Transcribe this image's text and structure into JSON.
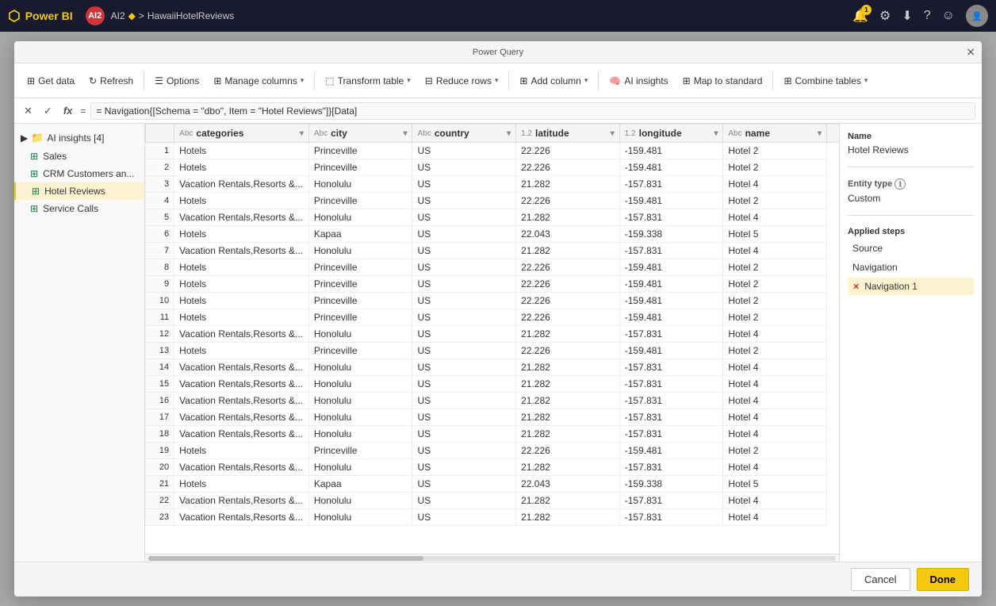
{
  "topbar": {
    "logo": "Power BI",
    "workspace": "AI2",
    "separator": ">",
    "file": "HawaiiHotelReviews",
    "notification_count": "1",
    "icons": [
      "bell",
      "settings",
      "download",
      "help",
      "emoji",
      "user"
    ]
  },
  "modal_title": "Power Query",
  "modal_close": "✕",
  "toolbar": {
    "get_data": "Get data",
    "refresh": "Refresh",
    "options": "Options",
    "manage_columns": "Manage columns",
    "transform_table": "Transform table",
    "reduce_rows": "Reduce rows",
    "add_column": "Add column",
    "ai_insights": "AI insights",
    "map_to_standard": "Map to standard",
    "combine_tables": "Combine tables"
  },
  "formula_bar": {
    "formula": "= Navigation{[Schema = \"dbo\", Item = \"Hotel Reviews\"]}[Data]"
  },
  "sidebar": {
    "group_label": "AI insights [4]",
    "items": [
      {
        "id": "sales",
        "label": "Sales",
        "icon": "table",
        "active": false
      },
      {
        "id": "crm",
        "label": "CRM Customers an...",
        "icon": "table",
        "active": false
      },
      {
        "id": "hotel-reviews",
        "label": "Hotel Reviews",
        "icon": "table",
        "active": true
      },
      {
        "id": "service-calls",
        "label": "Service Calls",
        "icon": "table",
        "active": false
      }
    ]
  },
  "table": {
    "columns": [
      {
        "id": "categories",
        "label": "categories",
        "type": "Abc"
      },
      {
        "id": "city",
        "label": "city",
        "type": "Abc"
      },
      {
        "id": "country",
        "label": "country",
        "type": "Abc"
      },
      {
        "id": "latitude",
        "label": "latitude",
        "type": "1.2"
      },
      {
        "id": "longitude",
        "label": "longitude",
        "type": "1.2"
      },
      {
        "id": "name",
        "label": "name",
        "type": "Abc"
      }
    ],
    "rows": [
      {
        "num": 1,
        "categories": "Hotels",
        "city": "Princeville",
        "country": "US",
        "latitude": "22.226",
        "longitude": "-159.481",
        "name": "Hotel 2"
      },
      {
        "num": 2,
        "categories": "Hotels",
        "city": "Princeville",
        "country": "US",
        "latitude": "22.226",
        "longitude": "-159.481",
        "name": "Hotel 2"
      },
      {
        "num": 3,
        "categories": "Vacation Rentals,Resorts &...",
        "city": "Honolulu",
        "country": "US",
        "latitude": "21.282",
        "longitude": "-157.831",
        "name": "Hotel 4"
      },
      {
        "num": 4,
        "categories": "Hotels",
        "city": "Princeville",
        "country": "US",
        "latitude": "22.226",
        "longitude": "-159.481",
        "name": "Hotel 2"
      },
      {
        "num": 5,
        "categories": "Vacation Rentals,Resorts &...",
        "city": "Honolulu",
        "country": "US",
        "latitude": "21.282",
        "longitude": "-157.831",
        "name": "Hotel 4"
      },
      {
        "num": 6,
        "categories": "Hotels",
        "city": "Kapaa",
        "country": "US",
        "latitude": "22.043",
        "longitude": "-159.338",
        "name": "Hotel 5"
      },
      {
        "num": 7,
        "categories": "Vacation Rentals,Resorts &...",
        "city": "Honolulu",
        "country": "US",
        "latitude": "21.282",
        "longitude": "-157.831",
        "name": "Hotel 4"
      },
      {
        "num": 8,
        "categories": "Hotels",
        "city": "Princeville",
        "country": "US",
        "latitude": "22.226",
        "longitude": "-159.481",
        "name": "Hotel 2"
      },
      {
        "num": 9,
        "categories": "Hotels",
        "city": "Princeville",
        "country": "US",
        "latitude": "22.226",
        "longitude": "-159.481",
        "name": "Hotel 2"
      },
      {
        "num": 10,
        "categories": "Hotels",
        "city": "Princeville",
        "country": "US",
        "latitude": "22.226",
        "longitude": "-159.481",
        "name": "Hotel 2"
      },
      {
        "num": 11,
        "categories": "Hotels",
        "city": "Princeville",
        "country": "US",
        "latitude": "22.226",
        "longitude": "-159.481",
        "name": "Hotel 2"
      },
      {
        "num": 12,
        "categories": "Vacation Rentals,Resorts &...",
        "city": "Honolulu",
        "country": "US",
        "latitude": "21.282",
        "longitude": "-157.831",
        "name": "Hotel 4"
      },
      {
        "num": 13,
        "categories": "Hotels",
        "city": "Princeville",
        "country": "US",
        "latitude": "22.226",
        "longitude": "-159.481",
        "name": "Hotel 2"
      },
      {
        "num": 14,
        "categories": "Vacation Rentals,Resorts &...",
        "city": "Honolulu",
        "country": "US",
        "latitude": "21.282",
        "longitude": "-157.831",
        "name": "Hotel 4"
      },
      {
        "num": 15,
        "categories": "Vacation Rentals,Resorts &...",
        "city": "Honolulu",
        "country": "US",
        "latitude": "21.282",
        "longitude": "-157.831",
        "name": "Hotel 4"
      },
      {
        "num": 16,
        "categories": "Vacation Rentals,Resorts &...",
        "city": "Honolulu",
        "country": "US",
        "latitude": "21.282",
        "longitude": "-157.831",
        "name": "Hotel 4"
      },
      {
        "num": 17,
        "categories": "Vacation Rentals,Resorts &...",
        "city": "Honolulu",
        "country": "US",
        "latitude": "21.282",
        "longitude": "-157.831",
        "name": "Hotel 4"
      },
      {
        "num": 18,
        "categories": "Vacation Rentals,Resorts &...",
        "city": "Honolulu",
        "country": "US",
        "latitude": "21.282",
        "longitude": "-157.831",
        "name": "Hotel 4"
      },
      {
        "num": 19,
        "categories": "Hotels",
        "city": "Princeville",
        "country": "US",
        "latitude": "22.226",
        "longitude": "-159.481",
        "name": "Hotel 2"
      },
      {
        "num": 20,
        "categories": "Vacation Rentals,Resorts &...",
        "city": "Honolulu",
        "country": "US",
        "latitude": "21.282",
        "longitude": "-157.831",
        "name": "Hotel 4"
      },
      {
        "num": 21,
        "categories": "Hotels",
        "city": "Kapaa",
        "country": "US",
        "latitude": "22.043",
        "longitude": "-159.338",
        "name": "Hotel 5"
      },
      {
        "num": 22,
        "categories": "Vacation Rentals,Resorts &...",
        "city": "Honolulu",
        "country": "US",
        "latitude": "21.282",
        "longitude": "-157.831",
        "name": "Hotel 4"
      },
      {
        "num": 23,
        "categories": "Vacation Rentals,Resorts &...",
        "city": "Honolulu",
        "country": "US",
        "latitude": "21.282",
        "longitude": "-157.831",
        "name": "Hotel 4"
      }
    ]
  },
  "right_panel": {
    "name_label": "Name",
    "name_value": "Hotel Reviews",
    "entity_type_label": "Entity type",
    "entity_type_info": "ℹ",
    "entity_type_value": "Custom",
    "applied_steps_label": "Applied steps",
    "steps": [
      {
        "id": "source",
        "label": "Source",
        "active": false,
        "deletable": false
      },
      {
        "id": "navigation",
        "label": "Navigation",
        "active": false,
        "deletable": false
      },
      {
        "id": "navigation1",
        "label": "Navigation 1",
        "active": true,
        "deletable": true
      }
    ]
  },
  "footer": {
    "cancel_label": "Cancel",
    "done_label": "Done"
  }
}
